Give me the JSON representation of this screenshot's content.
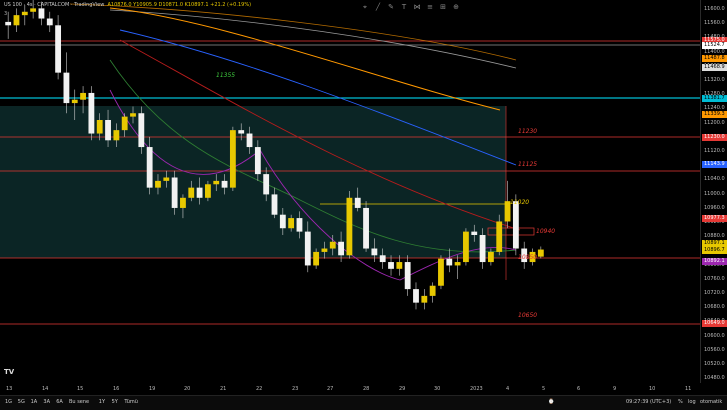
{
  "header": {
    "symbol": "US 100 · 4s · CAPITALCOM · TradingView",
    "ohlc": "A10876.0 Y10905.9 D10871.0 K10897.1 +21.2 (+0.19%)",
    "badge": "3"
  },
  "price_axis": {
    "labels": [
      "11600.0",
      "11560.0",
      "11480.0",
      "11400.0",
      "11360.0",
      "11320.0",
      "11280.0",
      "11240.0",
      "11200.0",
      "11160.0",
      "11120.0",
      "11080.0",
      "11040.0",
      "11000.0",
      "10960.0",
      "10920.0",
      "10880.0",
      "10840.0",
      "10800.0",
      "10760.0",
      "10720.0",
      "10680.0",
      "10640.0",
      "10600.0",
      "10560.0",
      "10520.0",
      "10480.0"
    ],
    "tags": [
      {
        "text": "11575.0",
        "color": "#e53935",
        "fg": "#fff"
      },
      {
        "text": "11524.7",
        "color": "#ffffff",
        "fg": "#000"
      },
      {
        "text": "11487.8",
        "color": "#ff9800",
        "fg": "#000"
      },
      {
        "text": "11468.9",
        "color": "#dddddd",
        "fg": "#000"
      },
      {
        "text": "11381.7",
        "color": "#00bcd4",
        "fg": "#000"
      },
      {
        "text": "11339.3",
        "color": "#ff9800",
        "fg": "#000"
      },
      {
        "text": "11230.0",
        "color": "#e53935",
        "fg": "#fff"
      },
      {
        "text": "11143.9",
        "color": "#2962ff",
        "fg": "#fff"
      },
      {
        "text": "10977.3",
        "color": "#e53935",
        "fg": "#fff"
      },
      {
        "text": "10897.1",
        "color": "#e7c800",
        "fg": "#000"
      },
      {
        "text": "10896.7",
        "color": "#e7c800",
        "fg": "#000"
      },
      {
        "text": "10892.1",
        "color": "#9c27b0",
        "fg": "#fff"
      },
      {
        "text": "10649.0",
        "color": "#e53935",
        "fg": "#fff"
      }
    ]
  },
  "levels": {
    "l11355": "11355",
    "l11230": "11230",
    "l11125": "11125",
    "l11020": "11020",
    "l10940": "10940",
    "l10850": "10850",
    "l10650": "10650"
  },
  "time_axis": [
    "13",
    "14",
    "15",
    "16",
    "19",
    "20",
    "21",
    "22",
    "23",
    "27",
    "28",
    "29",
    "30",
    "2023",
    "4",
    "5",
    "6",
    "9",
    "10",
    "11"
  ],
  "bottom_bar": {
    "ranges": [
      "1G",
      "5G",
      "1A",
      "3A",
      "6A",
      "Bu sene",
      "1Y",
      "5Y",
      "Tümü"
    ],
    "clock": "09:27:39 (UTC+3)",
    "pct": "%",
    "log": "log",
    "auto": "otomatik"
  },
  "colors": {
    "candle": "#e7c800",
    "zone": "#0d2b2b",
    "red_line": "#e53935",
    "cyan_line": "#00bcd4",
    "yellow_line": "#e7c800"
  },
  "candles": [
    [
      11570,
      11600,
      11520,
      11560
    ],
    [
      11560,
      11610,
      11540,
      11590
    ],
    [
      11590,
      11620,
      11560,
      11600
    ],
    [
      11600,
      11640,
      11580,
      11610
    ],
    [
      11610,
      11630,
      11560,
      11580
    ],
    [
      11580,
      11600,
      11540,
      11560
    ],
    [
      11560,
      11590,
      11400,
      11420
    ],
    [
      11420,
      11480,
      11300,
      11330
    ],
    [
      11330,
      11370,
      11280,
      11340
    ],
    [
      11340,
      11380,
      11300,
      11360
    ],
    [
      11360,
      11380,
      11220,
      11240
    ],
    [
      11240,
      11300,
      11220,
      11280
    ],
    [
      11280,
      11310,
      11200,
      11220
    ],
    [
      11220,
      11270,
      11200,
      11250
    ],
    [
      11250,
      11300,
      11230,
      11290
    ],
    [
      11290,
      11320,
      11270,
      11300
    ],
    [
      11300,
      11320,
      11180,
      11200
    ],
    [
      11200,
      11230,
      11060,
      11080
    ],
    [
      11080,
      11120,
      11060,
      11100
    ],
    [
      11100,
      11130,
      11080,
      11110
    ],
    [
      11110,
      11130,
      11000,
      11020
    ],
    [
      11020,
      11060,
      10990,
      11050
    ],
    [
      11050,
      11100,
      11040,
      11080
    ],
    [
      11080,
      11110,
      11030,
      11050
    ],
    [
      11050,
      11100,
      11040,
      11090
    ],
    [
      11090,
      11120,
      11070,
      11100
    ],
    [
      11100,
      11120,
      11060,
      11080
    ],
    [
      11080,
      11260,
      11070,
      11250
    ],
    [
      11250,
      11270,
      11220,
      11240
    ],
    [
      11240,
      11260,
      11180,
      11200
    ],
    [
      11200,
      11220,
      11100,
      11120
    ],
    [
      11120,
      11140,
      11040,
      11060
    ],
    [
      11060,
      11080,
      10990,
      11000
    ],
    [
      11000,
      11020,
      10940,
      10960
    ],
    [
      10960,
      11000,
      10950,
      10990
    ],
    [
      10990,
      11010,
      10930,
      10950
    ],
    [
      10950,
      10980,
      10830,
      10850
    ],
    [
      10850,
      10900,
      10840,
      10890
    ],
    [
      10890,
      10920,
      10870,
      10900
    ],
    [
      10900,
      10940,
      10880,
      10920
    ],
    [
      10920,
      10950,
      10860,
      10880
    ],
    [
      10880,
      11070,
      10870,
      11050
    ],
    [
      11050,
      11080,
      11010,
      11020
    ],
    [
      11020,
      11040,
      10890,
      10900
    ],
    [
      10900,
      10930,
      10860,
      10880
    ],
    [
      10880,
      10900,
      10840,
      10860
    ],
    [
      10860,
      10880,
      10820,
      10840
    ],
    [
      10840,
      10880,
      10820,
      10860
    ],
    [
      10860,
      10880,
      10760,
      10780
    ],
    [
      10780,
      10800,
      10720,
      10740
    ],
    [
      10740,
      10780,
      10720,
      10760
    ],
    [
      10760,
      10800,
      10740,
      10790
    ],
    [
      10790,
      10880,
      10780,
      10870
    ],
    [
      10870,
      10900,
      10830,
      10850
    ],
    [
      10850,
      10880,
      10810,
      10860
    ],
    [
      10860,
      10960,
      10850,
      10950
    ],
    [
      10950,
      10970,
      10920,
      10940
    ],
    [
      10940,
      10960,
      10840,
      10860
    ],
    [
      10860,
      10900,
      10850,
      10890
    ],
    [
      10890,
      11000,
      10880,
      10980
    ],
    [
      10980,
      11100,
      10960,
      11040
    ],
    [
      11040,
      11060,
      10880,
      10900
    ],
    [
      10900,
      10920,
      10840,
      10860
    ],
    [
      10860,
      10900,
      10850,
      10890
    ],
    [
      10876,
      10906,
      10871,
      10897
    ]
  ]
}
